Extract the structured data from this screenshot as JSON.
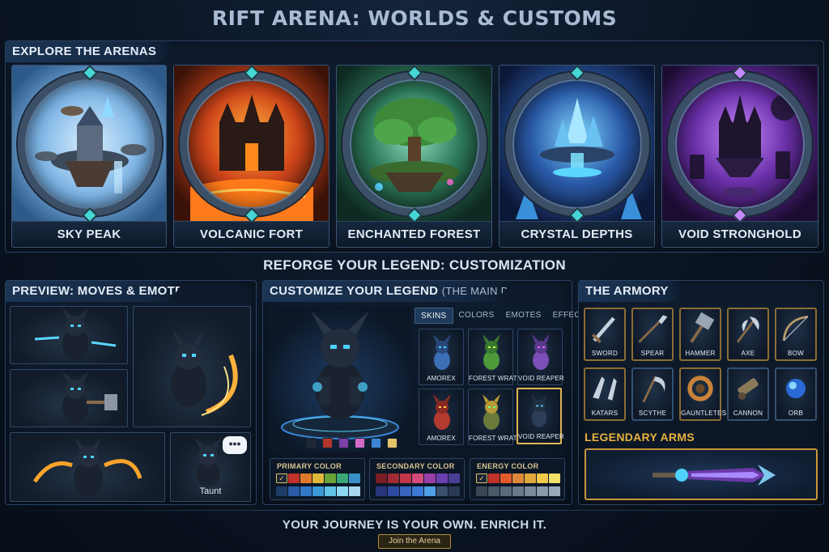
{
  "page_title": "RIFT ARENA: WORLDS & CUSTOMS",
  "arenas_panel": {
    "title": "EXPLORE THE ARENAS",
    "arenas": [
      {
        "name": "SKY PEAK",
        "theme_color": "#7fb6e6"
      },
      {
        "name": "VOLCANIC FORT",
        "theme_color": "#e8601c"
      },
      {
        "name": "ENCHANTED FOREST",
        "theme_color": "#3fa36a"
      },
      {
        "name": "CRYSTAL DEPTHS",
        "theme_color": "#3d8fd9"
      },
      {
        "name": "VOID STRONGHOLD",
        "theme_color": "#8a4fc9"
      }
    ]
  },
  "customization_title": "REFORGE YOUR LEGEND: CUSTOMIZATION",
  "preview_panel": {
    "title": "PREVIEW: MOVES & EMOTES",
    "taunt_label": "Taunt",
    "speech_bubble": "•••"
  },
  "customize_panel": {
    "title": "CUSTOMIZE YOUR LEGEND",
    "subtitle": "(THE MAIN DISPLAY)",
    "tabs": [
      {
        "label": "SKINS",
        "active": true
      },
      {
        "label": "COLORS",
        "active": false
      },
      {
        "label": "EMOTES",
        "active": false
      },
      {
        "label": "EFFECTS",
        "active": false
      }
    ],
    "skins": [
      {
        "name": "AMOREX",
        "color": "#3b6fb6"
      },
      {
        "name": "FOREST WRATH",
        "color": "#4c9a3a"
      },
      {
        "name": "VOID REAPER",
        "color": "#7a4fb8"
      },
      {
        "name": "AMOREX",
        "color": "#b23a2e"
      },
      {
        "name": "FOREST WRATH",
        "color": "#b89a36"
      },
      {
        "name": "VOID REAPER",
        "color": "#2c3e55",
        "selected": true
      }
    ],
    "stand_swatches": [
      "#1d2736",
      "#b2362c",
      "#7a3fa8",
      "#d46ac8",
      "#3b86d6",
      "#e6c56a"
    ],
    "palettes": [
      {
        "title": "PRIMARY COLOR",
        "row1": [
          "#f0d067",
          "#c2312a",
          "#e07a2a",
          "#e0b83a",
          "#6aa33a",
          "#38a676",
          "#3a8fc9"
        ],
        "row2": [
          "#1d3c66",
          "#2a5aa5",
          "#3478c9",
          "#3a9ad6",
          "#5fc2e6",
          "#8cd8f0",
          "#a9d6f0"
        ],
        "checked_index": 0
      },
      {
        "title": "SECONDARY COLOR",
        "row1": [
          "#7a1d24",
          "#a12b32",
          "#c2364a",
          "#d44a7a",
          "#9a3fa8",
          "#6a3fb0",
          "#4a3f96"
        ],
        "row2": [
          "#27357a",
          "#2e4aa0",
          "#3a66c0",
          "#3a7ad6",
          "#4ea0e6",
          "#3a4f6a",
          "#2a3a52"
        ],
        "checked_index": -1
      },
      {
        "title": "ENERGY COLOR",
        "row1": [
          "#f0d067",
          "#c2312a",
          "#e05a2a",
          "#e0883a",
          "#e0a83a",
          "#f0c84a",
          "#f0e06a"
        ],
        "row2": [
          "#3a4654",
          "#4a5868",
          "#5a6a7c",
          "#6a7a8c",
          "#7a8a9c",
          "#8a9aac",
          "#9aaabc"
        ],
        "checked_index": 0
      }
    ]
  },
  "armory_panel": {
    "title": "THE ARMORY",
    "weapons": [
      {
        "name": "SWORD",
        "icon": "sword-icon"
      },
      {
        "name": "SPEAR",
        "icon": "spear-icon"
      },
      {
        "name": "HAMMER",
        "icon": "hammer-icon"
      },
      {
        "name": "AXE",
        "icon": "axe-icon"
      },
      {
        "name": "BOW",
        "icon": "bow-icon"
      },
      {
        "name": "KATARS",
        "icon": "katars-icon"
      },
      {
        "name": "SCYTHE",
        "icon": "scythe-icon"
      },
      {
        "name": "GAUNTLETES",
        "icon": "gauntlets-icon"
      },
      {
        "name": "CANNON",
        "icon": "cannon-icon"
      },
      {
        "name": "ORB",
        "icon": "orb-icon"
      }
    ],
    "legendary_title": "LEGENDARY ARMS",
    "legendary_icon": "legendary-blade-icon"
  },
  "footer": {
    "tagline": "YOUR JOURNEY IS YOUR OWN. ENRICH IT.",
    "join_button": "Join the Arena"
  },
  "colors": {
    "accent_gold": "#e8b33c",
    "glow_blue": "#4fd2ff",
    "panel_border": "#2a4262"
  }
}
